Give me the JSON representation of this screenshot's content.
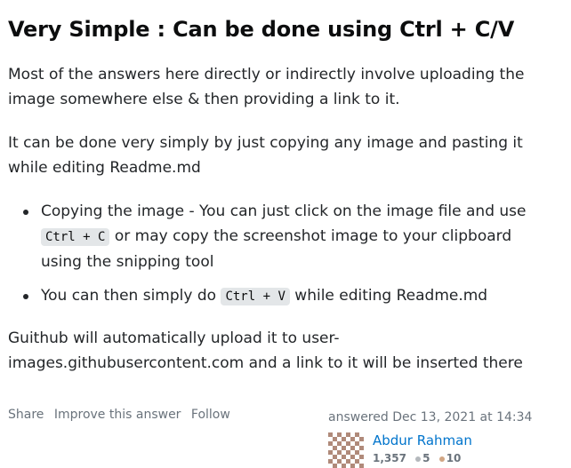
{
  "answer": {
    "heading": "Very Simple : Can be done using Ctrl + C/V",
    "para1": "Most of the answers here directly or indirectly involve uploading the image somewhere else & then providing a link to it.",
    "para2": "It can be done very simply by just copying any image and pasting it while editing Readme.md",
    "bullets": [
      {
        "text_before": "Copying the image - You can just click on the image file and use ",
        "code": "Ctrl + C",
        "text_after": " or may copy the screenshot image to your clipboard using the snipping tool"
      },
      {
        "text_before": "You can then simply do ",
        "code": "Ctrl + V",
        "text_after": " while editing Readme.md"
      }
    ],
    "para3": "Guithub will automatically upload it to user-images.githubusercontent.com and a link to it will be inserted there"
  },
  "post_actions": {
    "share": "Share",
    "improve": "Improve this answer",
    "follow": "Follow"
  },
  "signature": {
    "action": "answered",
    "time": "Dec 13, 2021 at 14:34",
    "user_name": "Abdur Rahman",
    "reputation": "1,357",
    "silver_badges": "5",
    "bronze_badges": "10",
    "colors": {
      "link": "#0074cc",
      "silver": "#b4b8bc",
      "bronze": "#d1a684"
    }
  }
}
